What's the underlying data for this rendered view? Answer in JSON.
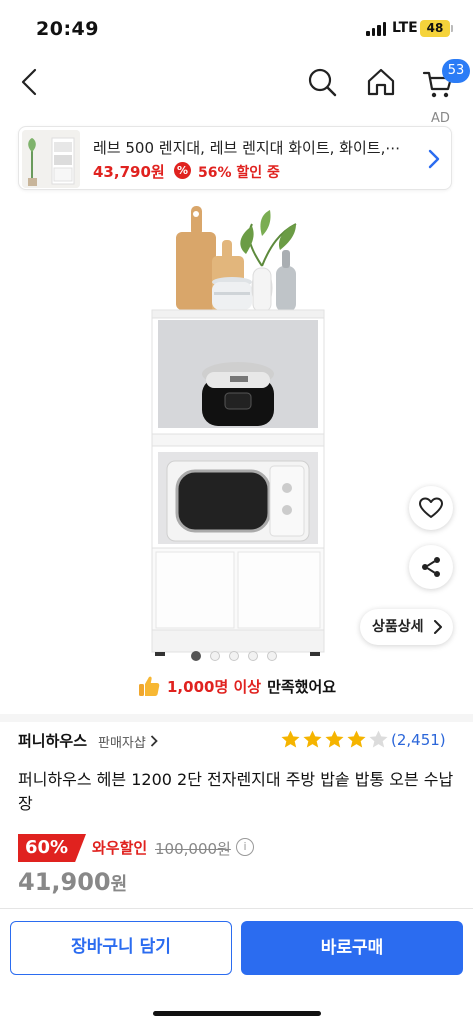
{
  "status_bar": {
    "time": "20:49",
    "network": "LTE",
    "battery": "48"
  },
  "nav": {
    "cart_count": "53"
  },
  "ad": {
    "tag": "AD",
    "title": "레브 500 렌지대, 레브 렌지대 화이트, 화이트,⋯",
    "price": "43,790원",
    "discount": "56% 할인 중",
    "discount_icon": "%"
  },
  "gallery": {
    "total_images": 5,
    "current_index": 1
  },
  "actions": {
    "detail_label": "상품상세"
  },
  "satisfaction": {
    "highlight": "1,000명 이상",
    "rest": "만족했어요"
  },
  "seller": {
    "name": "퍼니하우스",
    "sub": "판매자샵"
  },
  "rating": {
    "stars": 4,
    "max": 5,
    "reviews": "(2,451)"
  },
  "product": {
    "name": "퍼니하우스 헤븐 1200 2단 전자렌지대 주방 밥솥 밥통 오븐 수납장"
  },
  "price": {
    "discount_pct": "60%",
    "wow_label": "와우할인",
    "original": "100,000원",
    "info": "i",
    "final_amount": "41,900",
    "final_unit": "원"
  },
  "bottom": {
    "cart_label": "장바구니 담기",
    "buy_label": "바로구매"
  },
  "colors": {
    "accent_blue": "#2b6cf0",
    "sale_red": "#e0221f",
    "star": "#f5b400"
  }
}
